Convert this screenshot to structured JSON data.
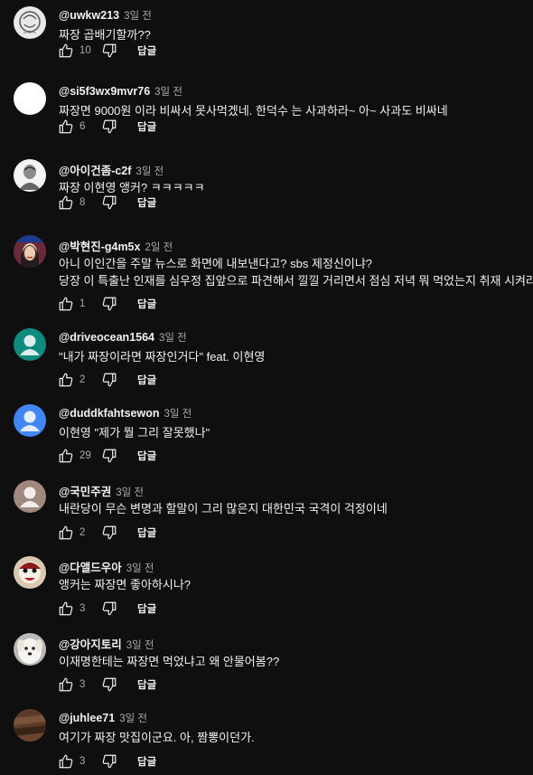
{
  "comments": [
    {
      "author": "@uwkw213",
      "time": "3일 전",
      "text": "짜장 곱배기할까??",
      "likes": "10",
      "reply": "답글",
      "avatar": "sketch",
      "avatar_bg": "#e8e8e8"
    },
    {
      "author": "@si5f3wx9mvr76",
      "time": "3일 전",
      "text": "짜장면 9000원 이라 비싸서 못사먹겠네. 한덕수 는 사과하라~ 아~ 사과도 비싸네",
      "likes": "6",
      "reply": "답글",
      "avatar": "blank",
      "avatar_bg": "#ffffff"
    },
    {
      "author": "@아이건좀-c2f",
      "time": "3일 전",
      "text": "짜장 이현영 앵커? ㅋㅋㅋㅋㅋ",
      "likes": "8",
      "reply": "답글",
      "avatar": "bust",
      "avatar_bg": "#f4f4f4"
    },
    {
      "author": "@박현진-g4m5x",
      "time": "2일 전",
      "text": "아니 이인간을 주말 뉴스로 화면에 내보낸다고? sbs 제정신이냐?\n당장 이 특출난 인재를 심우정 집앞으로 파견해서 낄낄 거리면서 점심 저녁 뭐 먹었는지 취재 시켜라.",
      "likes": "1",
      "reply": "답글",
      "avatar": "woman",
      "avatar_bg": "#6a2a3a"
    },
    {
      "author": "@driveocean1564",
      "time": "3일 전",
      "text": "\"내가 짜장이라면 짜장인거다\" feat. 이현영",
      "likes": "2",
      "reply": "답글",
      "avatar": "default-teal",
      "avatar_bg": "#0f8a7e"
    },
    {
      "author": "@duddkfahtsewon",
      "time": "3일 전",
      "text": "이현영 \"제가 뭘 그리 잘못했나\"",
      "likes": "29",
      "reply": "답글",
      "avatar": "default-blue",
      "avatar_bg": "#4285f4"
    },
    {
      "author": "@국민주권",
      "time": "3일 전",
      "text": "내란당이 무슨 변명과 할말이 그리 많은지 대한민국 국격이 걱정이네",
      "likes": "2",
      "reply": "답글",
      "avatar": "default-rose",
      "avatar_bg": "#a1887f"
    },
    {
      "author": "@다앨드우아",
      "time": "3일 전",
      "text": "앵커는 짜장면 좋아하시나?",
      "likes": "3",
      "reply": "답글",
      "avatar": "clown",
      "avatar_bg": "#d8c9b0"
    },
    {
      "author": "@강아지토리",
      "time": "3일 전",
      "text": "이재명한테는 짜장면 먹었냐고 왜 안물어봄??",
      "likes": "3",
      "reply": "답글",
      "avatar": "dog",
      "avatar_bg": "#b9b9b9"
    },
    {
      "author": "@juhlee71",
      "time": "3일 전",
      "text": "여기가 짜장 맛집이군요. 아, 짬뽕이던가.",
      "likes": "3",
      "reply": "답글",
      "avatar": "wood",
      "avatar_bg": "#5a3a28"
    }
  ]
}
